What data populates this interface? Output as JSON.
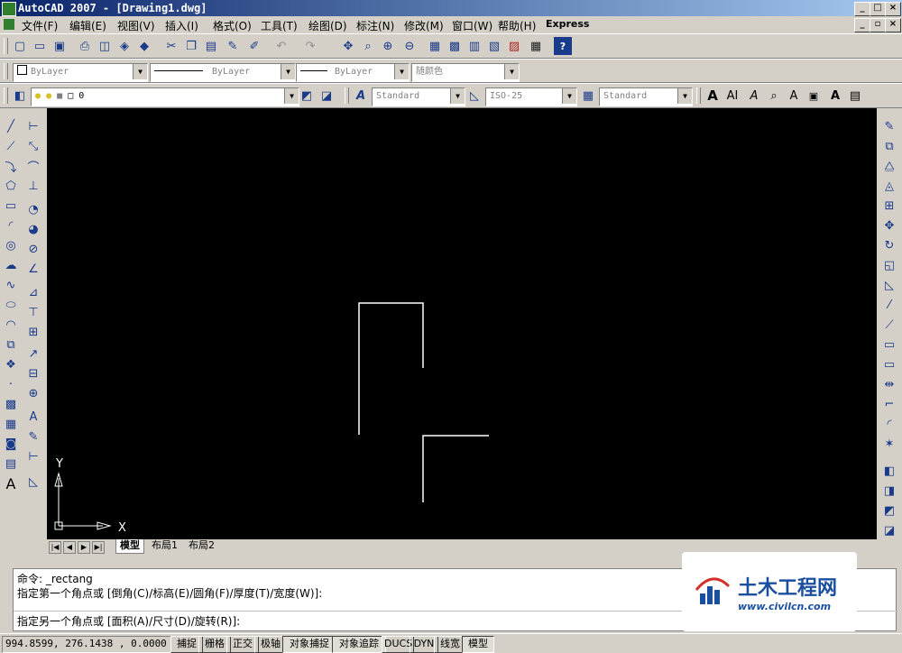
{
  "window": {
    "title": "AutoCAD 2007 - [Drawing1.dwg]",
    "controls": [
      "_",
      "□",
      "×"
    ]
  },
  "menu": {
    "items": [
      "文件(F)",
      "编辑(E)",
      "视图(V)",
      "插入(I)",
      "格式(O)",
      "工具(T)",
      "绘图(D)",
      "标注(N)",
      "修改(M)",
      "窗口(W)",
      "帮助(H)",
      "Express"
    ],
    "doc_controls": [
      "_",
      "▫",
      "×"
    ]
  },
  "properties": {
    "color": "ByLayer",
    "linetype": "ByLayer",
    "lineweight": "ByLayer",
    "plotstyle": "随颜色"
  },
  "layer": {
    "current": "0"
  },
  "styles": {
    "text_style": "Standard",
    "dim_style": "ISO-25",
    "table_style": "Standard"
  },
  "ucs": {
    "x_label": "X",
    "y_label": "Y"
  },
  "tabs": {
    "model": "模型",
    "layout1": "布局1",
    "layout2": "布局2"
  },
  "command": {
    "line1": "命令:  _rectang",
    "line2": "指定第一个角点或 [倒角(C)/标高(E)/圆角(F)/厚度(T)/宽度(W)]:",
    "line3": "指定另一个角点或 [面积(A)/尺寸(D)/旋转(R)]:"
  },
  "status": {
    "coords": "994.8599,  276.1438 , 0.0000",
    "snap": "捕捉",
    "grid": "栅格",
    "ortho": "正交",
    "polar": "极轴",
    "osnap": "对象捕捉",
    "otrack": "对象追踪",
    "ducs": "DUCS",
    "dyn": "DYN",
    "lwt": "线宽",
    "model": "模型"
  },
  "watermark": {
    "text": "土木工程网",
    "url": "www.civilcn.com"
  },
  "colors": {
    "canvas": "#000000",
    "title_start": "#0a246a",
    "title_end": "#a6caf0",
    "chrome": "#d4d0c8",
    "watermark_blue": "#1a4fa0",
    "watermark_red": "#d2302a"
  }
}
